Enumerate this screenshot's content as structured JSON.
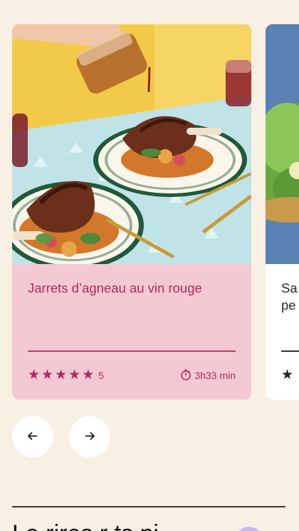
{
  "cards": [
    {
      "title": "Jarrets d’agneau au vin rouge",
      "rating": "5",
      "time": "3h33 min",
      "stars": 5
    },
    {
      "title": "Sa pe",
      "title_line1": "Sa",
      "title_line2": "pe"
    }
  ],
  "nav": {
    "prev_icon": "arrow-left-icon",
    "next_icon": "arrow-right-icon"
  },
  "section": {
    "heading": "Le rires r ts ni..."
  },
  "colors": {
    "background": "#f8f0e3",
    "card_pink": "#f2c9d3",
    "accent": "#b02a5e"
  }
}
